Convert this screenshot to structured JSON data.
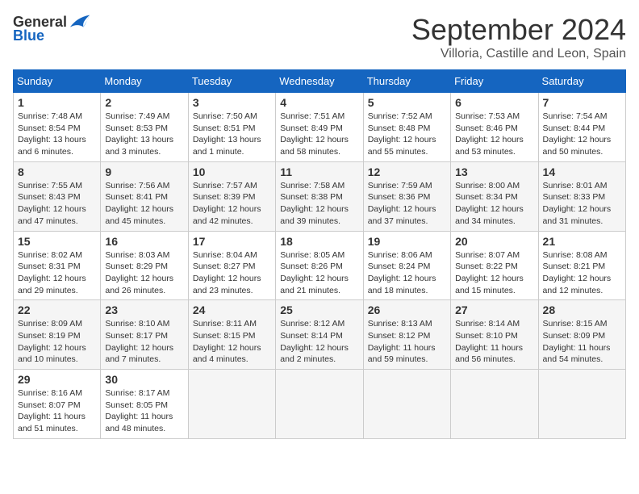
{
  "logo": {
    "general": "General",
    "blue": "Blue"
  },
  "title": "September 2024",
  "location": "Villoria, Castille and Leon, Spain",
  "days_of_week": [
    "Sunday",
    "Monday",
    "Tuesday",
    "Wednesday",
    "Thursday",
    "Friday",
    "Saturday"
  ],
  "weeks": [
    [
      {
        "day": "1",
        "sunrise": "Sunrise: 7:48 AM",
        "sunset": "Sunset: 8:54 PM",
        "daylight": "Daylight: 13 hours and 6 minutes."
      },
      {
        "day": "2",
        "sunrise": "Sunrise: 7:49 AM",
        "sunset": "Sunset: 8:53 PM",
        "daylight": "Daylight: 13 hours and 3 minutes."
      },
      {
        "day": "3",
        "sunrise": "Sunrise: 7:50 AM",
        "sunset": "Sunset: 8:51 PM",
        "daylight": "Daylight: 13 hours and 1 minute."
      },
      {
        "day": "4",
        "sunrise": "Sunrise: 7:51 AM",
        "sunset": "Sunset: 8:49 PM",
        "daylight": "Daylight: 12 hours and 58 minutes."
      },
      {
        "day": "5",
        "sunrise": "Sunrise: 7:52 AM",
        "sunset": "Sunset: 8:48 PM",
        "daylight": "Daylight: 12 hours and 55 minutes."
      },
      {
        "day": "6",
        "sunrise": "Sunrise: 7:53 AM",
        "sunset": "Sunset: 8:46 PM",
        "daylight": "Daylight: 12 hours and 53 minutes."
      },
      {
        "day": "7",
        "sunrise": "Sunrise: 7:54 AM",
        "sunset": "Sunset: 8:44 PM",
        "daylight": "Daylight: 12 hours and 50 minutes."
      }
    ],
    [
      {
        "day": "8",
        "sunrise": "Sunrise: 7:55 AM",
        "sunset": "Sunset: 8:43 PM",
        "daylight": "Daylight: 12 hours and 47 minutes."
      },
      {
        "day": "9",
        "sunrise": "Sunrise: 7:56 AM",
        "sunset": "Sunset: 8:41 PM",
        "daylight": "Daylight: 12 hours and 45 minutes."
      },
      {
        "day": "10",
        "sunrise": "Sunrise: 7:57 AM",
        "sunset": "Sunset: 8:39 PM",
        "daylight": "Daylight: 12 hours and 42 minutes."
      },
      {
        "day": "11",
        "sunrise": "Sunrise: 7:58 AM",
        "sunset": "Sunset: 8:38 PM",
        "daylight": "Daylight: 12 hours and 39 minutes."
      },
      {
        "day": "12",
        "sunrise": "Sunrise: 7:59 AM",
        "sunset": "Sunset: 8:36 PM",
        "daylight": "Daylight: 12 hours and 37 minutes."
      },
      {
        "day": "13",
        "sunrise": "Sunrise: 8:00 AM",
        "sunset": "Sunset: 8:34 PM",
        "daylight": "Daylight: 12 hours and 34 minutes."
      },
      {
        "day": "14",
        "sunrise": "Sunrise: 8:01 AM",
        "sunset": "Sunset: 8:33 PM",
        "daylight": "Daylight: 12 hours and 31 minutes."
      }
    ],
    [
      {
        "day": "15",
        "sunrise": "Sunrise: 8:02 AM",
        "sunset": "Sunset: 8:31 PM",
        "daylight": "Daylight: 12 hours and 29 minutes."
      },
      {
        "day": "16",
        "sunrise": "Sunrise: 8:03 AM",
        "sunset": "Sunset: 8:29 PM",
        "daylight": "Daylight: 12 hours and 26 minutes."
      },
      {
        "day": "17",
        "sunrise": "Sunrise: 8:04 AM",
        "sunset": "Sunset: 8:27 PM",
        "daylight": "Daylight: 12 hours and 23 minutes."
      },
      {
        "day": "18",
        "sunrise": "Sunrise: 8:05 AM",
        "sunset": "Sunset: 8:26 PM",
        "daylight": "Daylight: 12 hours and 21 minutes."
      },
      {
        "day": "19",
        "sunrise": "Sunrise: 8:06 AM",
        "sunset": "Sunset: 8:24 PM",
        "daylight": "Daylight: 12 hours and 18 minutes."
      },
      {
        "day": "20",
        "sunrise": "Sunrise: 8:07 AM",
        "sunset": "Sunset: 8:22 PM",
        "daylight": "Daylight: 12 hours and 15 minutes."
      },
      {
        "day": "21",
        "sunrise": "Sunrise: 8:08 AM",
        "sunset": "Sunset: 8:21 PM",
        "daylight": "Daylight: 12 hours and 12 minutes."
      }
    ],
    [
      {
        "day": "22",
        "sunrise": "Sunrise: 8:09 AM",
        "sunset": "Sunset: 8:19 PM",
        "daylight": "Daylight: 12 hours and 10 minutes."
      },
      {
        "day": "23",
        "sunrise": "Sunrise: 8:10 AM",
        "sunset": "Sunset: 8:17 PM",
        "daylight": "Daylight: 12 hours and 7 minutes."
      },
      {
        "day": "24",
        "sunrise": "Sunrise: 8:11 AM",
        "sunset": "Sunset: 8:15 PM",
        "daylight": "Daylight: 12 hours and 4 minutes."
      },
      {
        "day": "25",
        "sunrise": "Sunrise: 8:12 AM",
        "sunset": "Sunset: 8:14 PM",
        "daylight": "Daylight: 12 hours and 2 minutes."
      },
      {
        "day": "26",
        "sunrise": "Sunrise: 8:13 AM",
        "sunset": "Sunset: 8:12 PM",
        "daylight": "Daylight: 11 hours and 59 minutes."
      },
      {
        "day": "27",
        "sunrise": "Sunrise: 8:14 AM",
        "sunset": "Sunset: 8:10 PM",
        "daylight": "Daylight: 11 hours and 56 minutes."
      },
      {
        "day": "28",
        "sunrise": "Sunrise: 8:15 AM",
        "sunset": "Sunset: 8:09 PM",
        "daylight": "Daylight: 11 hours and 54 minutes."
      }
    ],
    [
      {
        "day": "29",
        "sunrise": "Sunrise: 8:16 AM",
        "sunset": "Sunset: 8:07 PM",
        "daylight": "Daylight: 11 hours and 51 minutes."
      },
      {
        "day": "30",
        "sunrise": "Sunrise: 8:17 AM",
        "sunset": "Sunset: 8:05 PM",
        "daylight": "Daylight: 11 hours and 48 minutes."
      },
      null,
      null,
      null,
      null,
      null
    ]
  ]
}
